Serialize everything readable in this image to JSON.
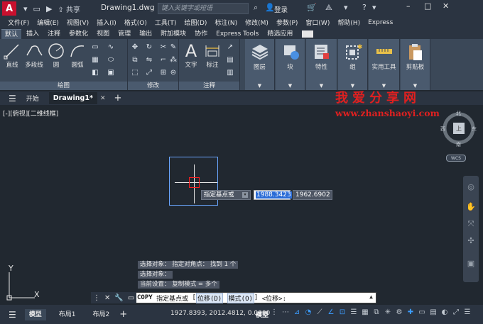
{
  "titlebar": {
    "app_logo": "A",
    "share": "共享",
    "doc_title": "Drawing1.dwg",
    "search_placeholder": "键入关键字或短语",
    "login": "登录"
  },
  "menu": [
    "文件(F)",
    "编辑(E)",
    "视图(V)",
    "插入(I)",
    "格式(O)",
    "工具(T)",
    "绘图(D)",
    "标注(N)",
    "修改(M)",
    "参数(P)",
    "窗口(W)",
    "帮助(H)",
    "Express"
  ],
  "ribbon_tabs": [
    "默认",
    "插入",
    "注释",
    "参数化",
    "视图",
    "管理",
    "输出",
    "附加模块",
    "协作",
    "Express Tools",
    "精选应用"
  ],
  "ribbon": {
    "draw_panel_title": "绘图",
    "modify_panel_title": "修改",
    "annotate_panel_title": "注释",
    "tools": {
      "line": "直线",
      "polyline": "多段线",
      "circle": "圆",
      "arc": "圆弧",
      "text": "文字",
      "dimension": "标注"
    },
    "big_buttons": {
      "layers": "图层",
      "block": "块",
      "properties": "特性",
      "groups": "组",
      "utilities": "实用工具",
      "clipboard": "剪贴板"
    }
  },
  "doc_tabs": {
    "start": "开始",
    "current": "Drawing1*"
  },
  "watermark": {
    "cn": "我爱分享网",
    "url": "www.zhanshaoyi.com"
  },
  "viewport_label": "[-][俯视][二维线框]",
  "viewcube": {
    "north": "北",
    "south": "南",
    "west": "西",
    "east": "东",
    "face": "上",
    "wcs": "WCS"
  },
  "dynamic_input": {
    "prompt": "指定基点或",
    "x_value": "1988.3423",
    "y_value": "1962.6902"
  },
  "history": [
    "选择对象： 指定对角点： 找到 1 个",
    "选择对象：",
    "当前设置： 复制模式 = 多个"
  ],
  "ucs": {
    "x": "X",
    "y": "Y"
  },
  "command": {
    "name": "COPY",
    "prompt": "指定基点或",
    "opt1": "位移(D)",
    "opt2": "模式(O)",
    "tail": "<位移>:"
  },
  "statusbar": {
    "tabs": [
      "模型",
      "布局1",
      "布局2"
    ],
    "coords": "1927.8393, 2012.4812, 0.0000",
    "model": "模型"
  }
}
